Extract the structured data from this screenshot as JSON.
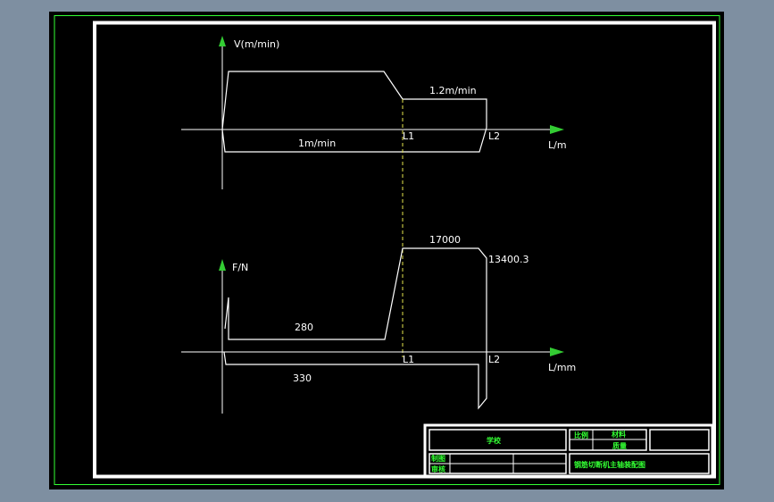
{
  "velocity_diagram": {
    "axis_y_label": "V(m/min)",
    "axis_x_label": "L/m",
    "forward_speed": "1.2m/min",
    "return_speed": "1m/min",
    "mark_l1": "L1",
    "mark_l2": "L2"
  },
  "force_diagram": {
    "axis_y_label": "F/N",
    "axis_x_label": "L/mm",
    "load_peak": "17000",
    "load_end": "13400.3",
    "load_start": "280",
    "return_load": "330",
    "mark_l1": "L1",
    "mark_l2": "L2"
  },
  "title_block": {
    "school": "学校",
    "scale": "比例",
    "material": "材料",
    "mass": "质量",
    "drawn_by": "制图",
    "checked_by": "审核",
    "drawing_title": "钢筋切断机主轴装配图"
  },
  "colors": {
    "frame": "#ffffff",
    "outer_border": "#33ff33",
    "curve": "#ffffff",
    "axis": "#ffffff",
    "arrow": "#33cc33",
    "dashed_marker": "#e6e64d",
    "title_text": "#33ff33"
  }
}
